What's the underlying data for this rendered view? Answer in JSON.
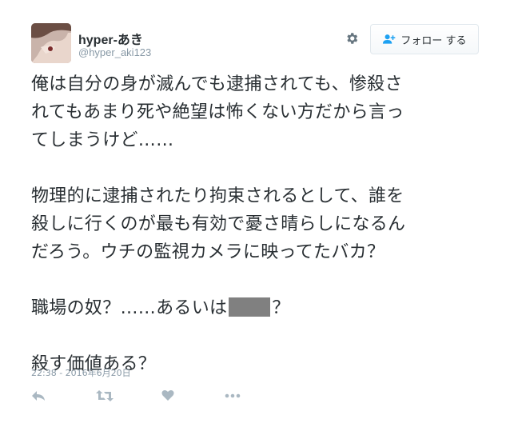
{
  "user": {
    "display_name": "hyper-あき",
    "screen_name": "@hyper_aki123"
  },
  "follow_button": {
    "label": "フォロー する"
  },
  "tweet": {
    "lines": [
      "俺は自分の身が滅んでも逮捕されても、惨殺さ",
      "れてもあまり死や絶望は怖くない方だから言っ",
      "てしまうけど……",
      "",
      "物理的に逮捕されたり拘束されるとして、誰を",
      "殺しに行くのが最も有効で憂さ晴らしになるん",
      "だろう。ウチの監視カメラに映ってたバカ？",
      ""
    ],
    "line_redacted_before": "職場の奴？……あるいは",
    "line_redacted_after": "？",
    "final_line": "殺す価値ある？",
    "timestamp": "22:38 - 2016年6月20日"
  },
  "icons": {
    "gear": "gear-icon",
    "follow": "person-add-icon",
    "reply": "reply-icon",
    "retweet": "retweet-icon",
    "like": "heart-icon",
    "more": "more-icon"
  },
  "colors": {
    "text": "#292f33",
    "muted": "#8899a6",
    "icon_gray": "#aab8c2",
    "follow_accent": "#1da1f2",
    "redacted": "#808080"
  }
}
